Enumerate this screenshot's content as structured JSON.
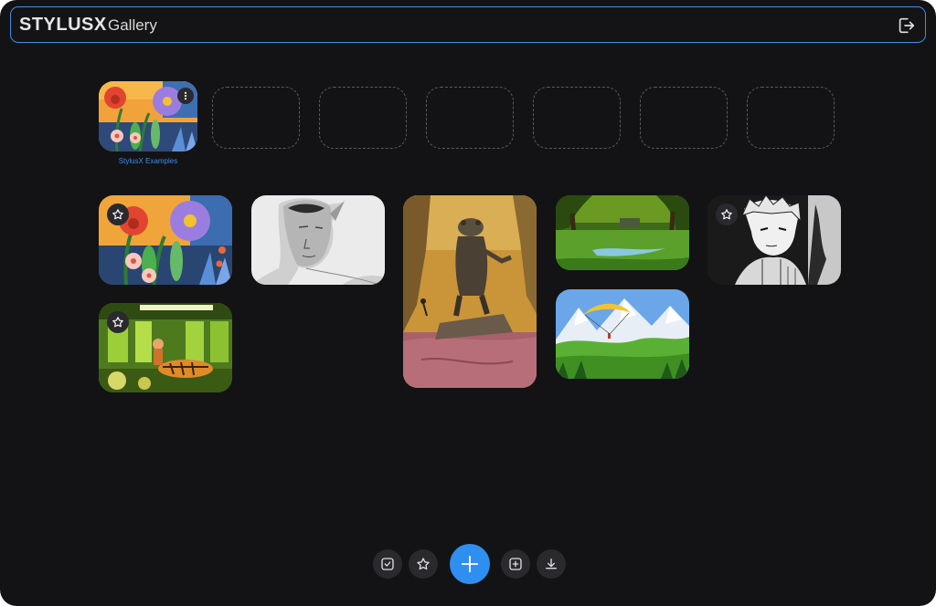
{
  "header": {
    "brand": "STYLUSX",
    "subtitle": "Gallery",
    "logout_icon": "logout-icon"
  },
  "folders": {
    "first_label": "StylusX Examples",
    "empty_slot_count": 6
  },
  "gallery": {
    "items": [
      {
        "name": "floral-illustration",
        "starred": true
      },
      {
        "name": "elf-sketch",
        "starred": false
      },
      {
        "name": "frog-warrior-painting",
        "starred": false
      },
      {
        "name": "forest-stream",
        "starred": false
      },
      {
        "name": "manga-boy",
        "starred": true
      },
      {
        "name": "tiger-subway",
        "starred": true
      },
      {
        "name": "paraglider-meadow",
        "starred": false
      }
    ]
  },
  "toolbar": {
    "buttons": [
      "select-icon",
      "star-icon",
      "plus-icon",
      "add-box-icon",
      "download-icon"
    ]
  },
  "colors": {
    "accent": "#2f8ff0",
    "background": "#131315",
    "header_border": "#3d8ee8"
  }
}
